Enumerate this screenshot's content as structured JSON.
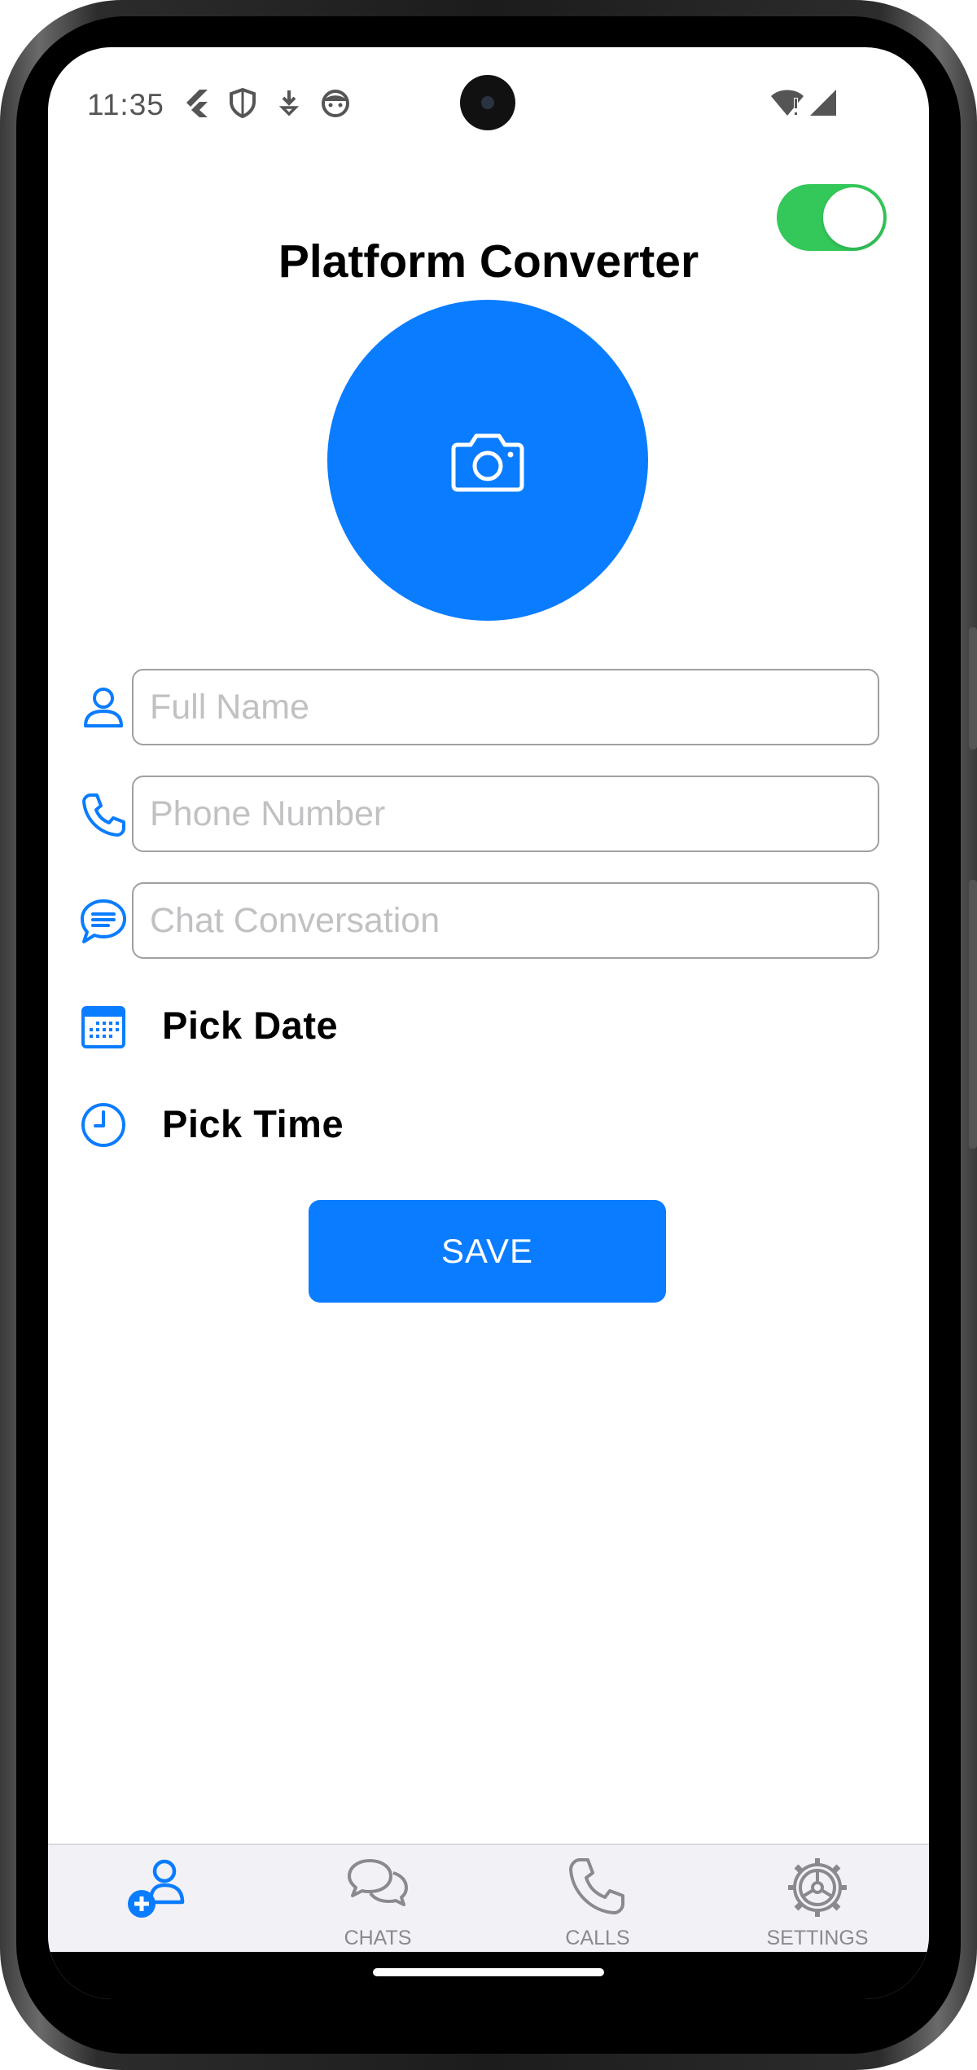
{
  "status_bar": {
    "time": "11:35",
    "left_icons": [
      "flutter-icon",
      "shield-icon",
      "download-icon",
      "android-face-icon"
    ],
    "right_icons": [
      "wifi-alert-icon",
      "signal-icon"
    ]
  },
  "header": {
    "title": "Platform Converter",
    "platform_toggle_on": true
  },
  "colors": {
    "accent": "#0a7cff",
    "toggle_on": "#34c759",
    "tab_inactive": "#8a8a8e",
    "placeholder": "#c1c1c4"
  },
  "profile": {
    "photo_icon": "camera-icon"
  },
  "form": {
    "full_name": {
      "icon": "person-icon",
      "placeholder": "Full Name",
      "value": ""
    },
    "phone_number": {
      "icon": "phone-icon",
      "placeholder": "Phone Number",
      "value": ""
    },
    "chat_conversation": {
      "icon": "chat-bubble-icon",
      "placeholder": "Chat Conversation",
      "value": ""
    },
    "pick_date": {
      "icon": "calendar-icon",
      "label": "Pick Date"
    },
    "pick_time": {
      "icon": "clock-icon",
      "label": "Pick Time"
    },
    "save_label": "SAVE"
  },
  "tabs": [
    {
      "icon": "add-contact-icon",
      "label": "",
      "selected": true
    },
    {
      "icon": "chats-icon",
      "label": "CHATS",
      "selected": false
    },
    {
      "icon": "calls-icon",
      "label": "CALLS",
      "selected": false
    },
    {
      "icon": "settings-icon",
      "label": "SETTINGS",
      "selected": false
    }
  ]
}
